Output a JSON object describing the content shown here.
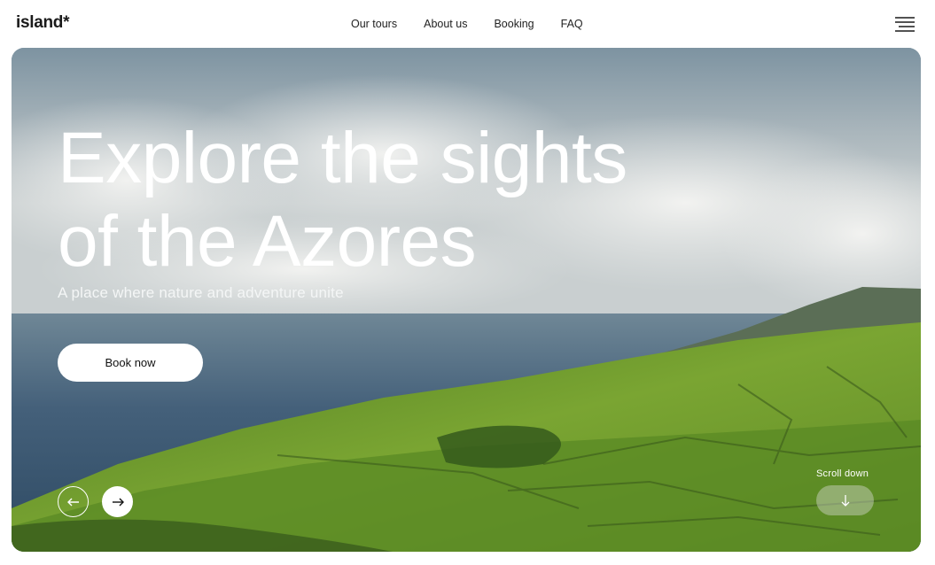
{
  "header": {
    "logo": "island*",
    "nav": [
      {
        "label": "Our tours"
      },
      {
        "label": "About us"
      },
      {
        "label": "Booking"
      },
      {
        "label": "FAQ"
      }
    ],
    "menu_icon": "hamburger-menu-icon"
  },
  "hero": {
    "title": "Explore the sights\nof the Azores",
    "subtitle": "A place where nature and adventure unite",
    "book_label": "Book now",
    "prev_icon": "arrow-left-icon",
    "next_icon": "arrow-right-icon",
    "scroll_label": "Scroll down",
    "scroll_icon": "arrow-down-icon"
  },
  "colors": {
    "text": "#1b1b1b",
    "white": "#ffffff",
    "grass": "#6e9a2e",
    "ocean": "#3d5a72"
  }
}
